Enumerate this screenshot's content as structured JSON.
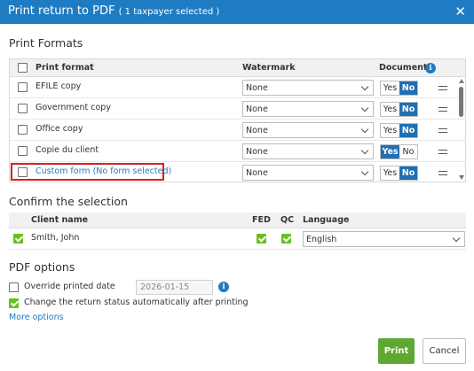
{
  "dialog": {
    "title": "Print return to PDF",
    "subtitle": "( 1 taxpayer selected )",
    "close_icon": "close-icon"
  },
  "print_formats": {
    "section_title": "Print Formats",
    "columns": {
      "format": "Print format",
      "watermark": "Watermark",
      "documents": "Documents"
    },
    "rows": [
      {
        "name": "EFILE copy",
        "watermark": "None",
        "documents": "No",
        "checked": false,
        "link": false,
        "highlighted": false
      },
      {
        "name": "Government copy",
        "watermark": "None",
        "documents": "No",
        "checked": false,
        "link": false,
        "highlighted": false
      },
      {
        "name": "Office copy",
        "watermark": "None",
        "documents": "No",
        "checked": false,
        "link": false,
        "highlighted": false
      },
      {
        "name": "Copie du client",
        "watermark": "None",
        "documents": "Yes",
        "checked": false,
        "link": false,
        "highlighted": false
      },
      {
        "name": "Custom form (No form selected)",
        "watermark": "None",
        "documents": "No",
        "checked": false,
        "link": true,
        "highlighted": true
      }
    ],
    "yes_label": "Yes",
    "no_label": "No"
  },
  "confirm": {
    "section_title": "Confirm the selection",
    "columns": {
      "client": "Client name",
      "fed": "FED",
      "qc": "QC",
      "language": "Language"
    },
    "rows": [
      {
        "client": "Smith, John",
        "fed": true,
        "qc": true,
        "language": "English",
        "checked": true
      }
    ]
  },
  "pdf_options": {
    "section_title": "PDF options",
    "override_label": "Override printed date",
    "override_checked": false,
    "date_value": "2026-01-15",
    "change_status_label": "Change the return status automatically after printing",
    "change_status_checked": true,
    "more_options": "More options"
  },
  "buttons": {
    "print": "Print",
    "cancel": "Cancel"
  },
  "colors": {
    "header": "#1f7cc2",
    "toggle_on": "#1f6fb3",
    "check": "#6bbf1e",
    "print_button": "#5ea832",
    "highlight_border": "#d42023"
  }
}
